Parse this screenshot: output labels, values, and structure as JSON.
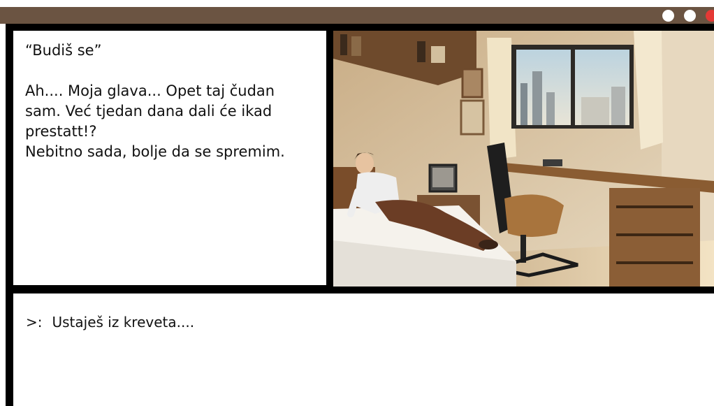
{
  "window": {
    "bar_color": "#6b5442",
    "controls": [
      {
        "name": "window-dot-1",
        "color": "#ffffff"
      },
      {
        "name": "window-dot-2",
        "color": "#ffffff"
      },
      {
        "name": "window-dot-close",
        "color": "#e53935"
      }
    ]
  },
  "story": {
    "lines": [
      "“Budiš se”",
      "",
      "Ah.... Moja glava... Opet taj čudan",
      "sam. Već tjedan dana dali će ikad",
      "prestatt!?",
      "Nebitno sada, bolje da se spremim."
    ]
  },
  "scene": {
    "illustration": "bedroom-scene-image"
  },
  "console": {
    "prompt": ">:",
    "text": "Ustaješ iz kreveta...."
  }
}
